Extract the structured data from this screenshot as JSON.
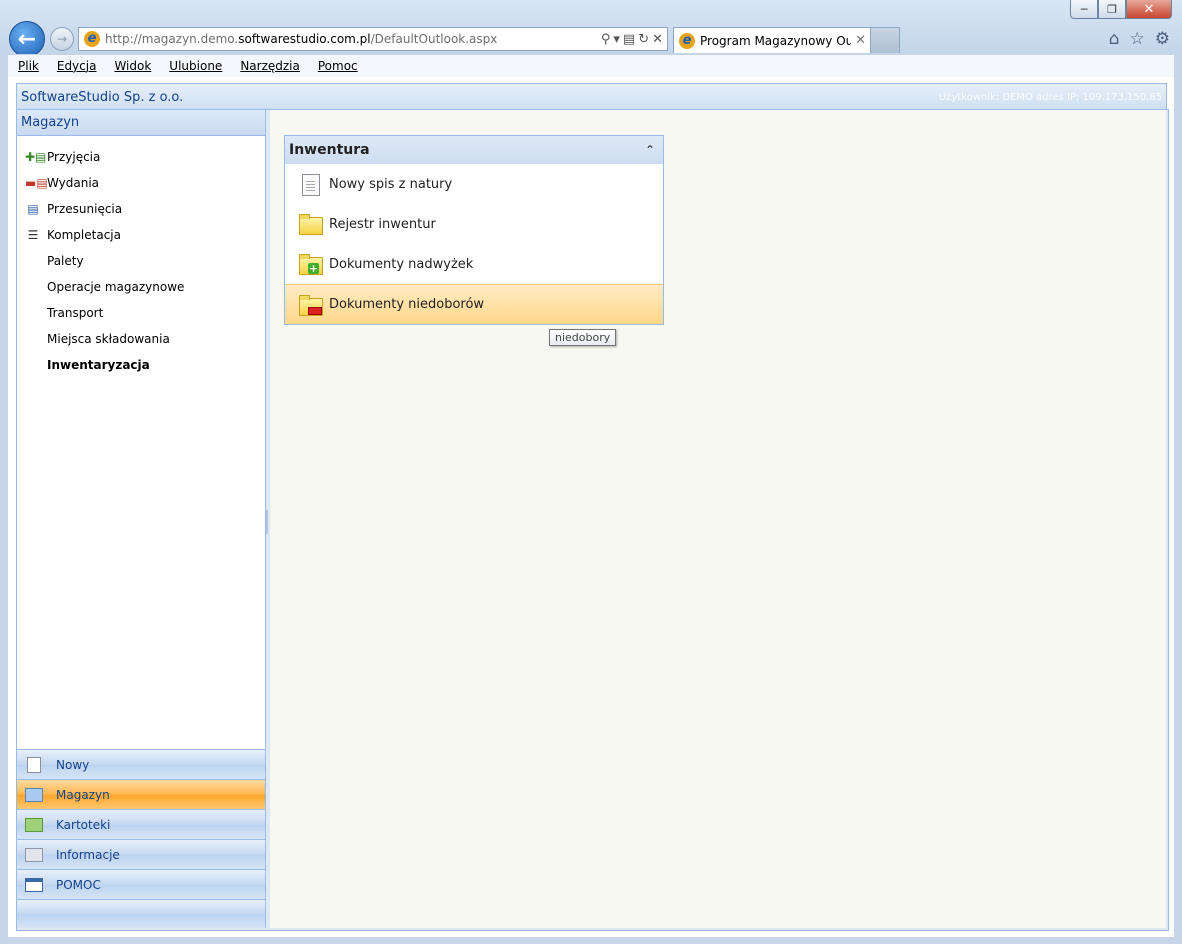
{
  "browser": {
    "address_url_prefix": "http://magazyn.demo.",
    "address_url_domain": "softwarestudio.com.pl",
    "address_url_path": "/DefaultOutlook.aspx",
    "tab_title": "Program Magazynowy Outl..."
  },
  "menubar": {
    "items": [
      "Plik",
      "Edycja",
      "Widok",
      "Ulubione",
      "Narzędzia",
      "Pomoc"
    ]
  },
  "app": {
    "company": "SoftwareStudio Sp. z o.o.",
    "user_info": "Użytkownik: DEMO adres IP: 109.173.150.85"
  },
  "sidebar": {
    "title": "Magazyn",
    "items": [
      {
        "label": "Przyjęcia",
        "icon": "goods-in-icon"
      },
      {
        "label": "Wydania",
        "icon": "goods-out-icon"
      },
      {
        "label": "Przesunięcia",
        "icon": "transfer-icon"
      },
      {
        "label": "Kompletacja",
        "icon": "list-icon"
      },
      {
        "label": "Palety"
      },
      {
        "label": "Operacje magazynowe"
      },
      {
        "label": "Transport"
      },
      {
        "label": "Miejsca składowania"
      },
      {
        "label": "Inwentaryzacja",
        "active": true
      }
    ],
    "sections": [
      {
        "label": "Nowy",
        "icon": "new-page-icon"
      },
      {
        "label": "Magazyn",
        "icon": "folder-blue-icon",
        "active": true
      },
      {
        "label": "Kartoteki",
        "icon": "folder-green-icon"
      },
      {
        "label": "Informacje",
        "icon": "folder-gray-icon"
      },
      {
        "label": "POMOC",
        "icon": "calendar-icon"
      }
    ]
  },
  "panel": {
    "title": "Inwentura",
    "items": [
      {
        "label": "Nowy spis z natury",
        "icon": "document-icon"
      },
      {
        "label": "Rejestr inwentur",
        "icon": "folder-icon"
      },
      {
        "label": "Dokumenty nadwyżek",
        "icon": "folder-add-icon"
      },
      {
        "label": "Dokumenty niedoborów",
        "icon": "folder-remove-icon",
        "hover": true
      }
    ]
  },
  "tooltip": "niedobory",
  "colors": {
    "accent": "#15428b",
    "active_section": "#ffb84f",
    "border": "#99bbe8"
  }
}
